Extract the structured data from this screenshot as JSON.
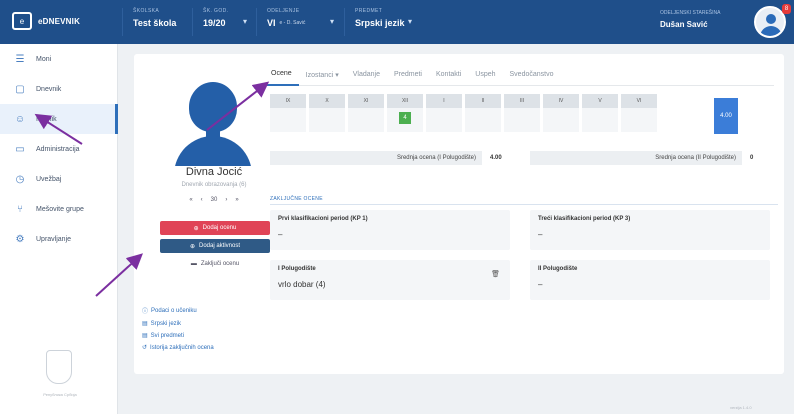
{
  "header": {
    "brand": "eDNEVNIK",
    "selectors": [
      {
        "label": "ŠKOLSKA",
        "value": "Test škola",
        "sub": ""
      },
      {
        "label": "ŠK. GOD.",
        "value": "19/20",
        "sub": ""
      },
      {
        "label": "ODELJENJE",
        "value": "VI",
        "sub": "e - D. Savić"
      },
      {
        "label": "PREDMET",
        "value": "Srpski jezik",
        "sub": ""
      }
    ],
    "user_role": "ODELJENSKI STAREŠINA",
    "user_name": "Dušan Savić",
    "notifications": "8"
  },
  "sidebar": {
    "items": [
      {
        "label": "Moni",
        "icon": "grid-icon"
      },
      {
        "label": "Dnevnik",
        "icon": "book-icon"
      },
      {
        "label": "Imenik",
        "icon": "users-icon"
      },
      {
        "label": "Administracija",
        "icon": "clipboard-icon"
      },
      {
        "label": "Uvežbaj",
        "icon": "clock-icon"
      },
      {
        "label": "Mešovite grupe",
        "icon": "branch-icon"
      },
      {
        "label": "Upravljanje",
        "icon": "gear-icon"
      }
    ],
    "active": "Imenik",
    "crest_caption": "Република Србија"
  },
  "student": {
    "name": "Divna Jocić",
    "subtitle": "Dnevnik obrazovanja (6)",
    "pager": [
      "«",
      "‹",
      "30",
      "›",
      "»"
    ],
    "actions": {
      "add_grade": "Dodaj ocenu",
      "add_activity": "Dodaj aktivnost",
      "close_grade": "Zaključi ocenu"
    },
    "links": [
      "Podaci o učeniku",
      "Srpski jezik",
      "Svi predmeti",
      "Istorija zaključnih ocena"
    ]
  },
  "tabs": [
    "Ocene",
    "Izostanci ▾",
    "Vladanje",
    "Predmeti",
    "Kontakti",
    "Uspeh",
    "Svedočanstvo"
  ],
  "active_tab": "Ocene",
  "grades": {
    "months": [
      "IX",
      "X",
      "XI",
      "XII",
      "I",
      "II",
      "III",
      "IV",
      "V",
      "VI"
    ],
    "values": [
      "",
      "",
      "",
      "4",
      "",
      "",
      "",
      "",
      "",
      ""
    ],
    "final_average": "4.00"
  },
  "averages": {
    "left_label": "Srednja ocena (I Polugodište)",
    "left_value": "4.00",
    "right_label": "Srednja ocena (II Polugodište)",
    "right_value": "0"
  },
  "closing": {
    "heading": "ZAKLJUČNE OCENE",
    "cards": [
      {
        "title": "Prvi klasifikacioni period (KP 1)",
        "value": "–"
      },
      {
        "title": "Treći klasifikacioni period (KP 3)",
        "value": "–"
      },
      {
        "title": "I Polugodište",
        "value": "vrlo dobar (4)"
      },
      {
        "title": "II Polugodište",
        "value": "–"
      }
    ]
  },
  "footer": "verzija 1.4.0",
  "colors": {
    "primary": "#1f4f8a",
    "accent": "#2e6fba",
    "danger": "#e04457",
    "success": "#4caf50",
    "arrow": "#7b2fa0"
  }
}
